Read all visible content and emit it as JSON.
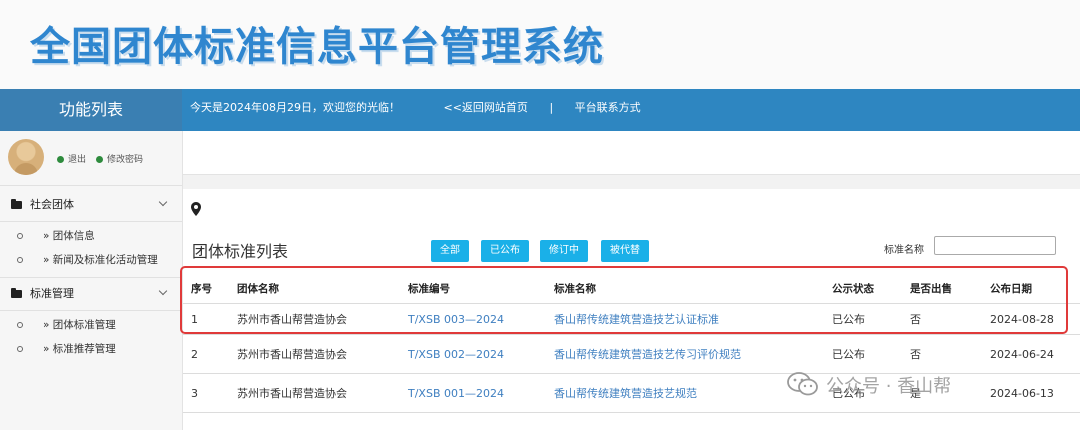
{
  "header": {
    "site_title": "全国团体标准信息平台管理系统"
  },
  "topbar": {
    "func_title": "功能列表",
    "welcome": "今天是2024年08月29日，欢迎您的光临！",
    "back_link": "<<返回网站首页",
    "separator": "|",
    "contact_link": "平台联系方式"
  },
  "user": {
    "logout": "退出",
    "change_password": "修改密码"
  },
  "sidebar": {
    "groups": [
      {
        "label": "社会团体",
        "items": [
          {
            "label": "» 团体信息"
          },
          {
            "label": "» 新闻及标准化活动管理"
          }
        ]
      },
      {
        "label": "标准管理",
        "items": [
          {
            "label": "» 团体标准管理"
          },
          {
            "label": "» 标准推荐管理"
          }
        ]
      }
    ]
  },
  "main": {
    "list_title": "团体标准列表",
    "filters": [
      "全部",
      "已公布",
      "修订中",
      "被代替"
    ],
    "search_label": "标准名称",
    "search_value": "",
    "table": {
      "headers": [
        "序号",
        "团体名称",
        "标准编号",
        "标准名称",
        "公示状态",
        "是否出售",
        "公布日期"
      ],
      "rows": [
        [
          "1",
          "苏州市香山帮营造协会",
          "T/XSB 003—2024",
          "香山帮传统建筑营造技艺认证标准",
          "已公布",
          "否",
          "2024-08-28"
        ],
        [
          "2",
          "苏州市香山帮营造协会",
          "T/XSB 002—2024",
          "香山帮传统建筑营造技艺传习评价规范",
          "已公布",
          "否",
          "2024-06-24"
        ],
        [
          "3",
          "苏州市香山帮营造协会",
          "T/XSB 001—2024",
          "香山帮传统建筑营造技艺规范",
          "已公布",
          "是",
          "2024-06-13"
        ]
      ]
    }
  },
  "watermark": "公众号 · 香山帮",
  "colors": {
    "title_blue": "#2f86cf",
    "bar_blue": "#2e86c1",
    "button_blue": "#1ab0e8",
    "link_blue": "#3f7fc0",
    "highlight_red": "#e03a3a"
  }
}
